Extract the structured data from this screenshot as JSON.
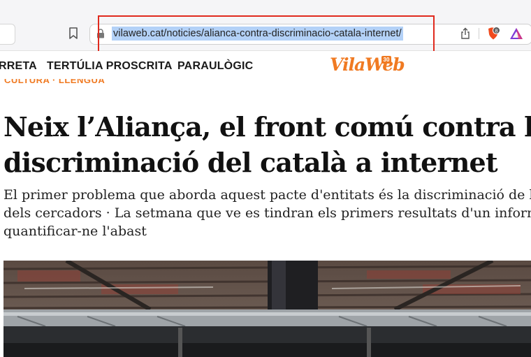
{
  "browser": {
    "url": "vilaweb.cat/noticies/alianca-contra-discriminacio-catala-internet/",
    "icons": [
      "bookmark-icon",
      "lock-icon",
      "share-icon",
      "brave-shields-icon",
      "brave-rewards-icon"
    ],
    "shields_count": "8"
  },
  "site": {
    "nav": [
      "RRETA",
      "TERTÚLIA PROSCRITA",
      "PARAULÒGIC"
    ],
    "logo": "VilaWeb",
    "logo_badge": "30",
    "brand_color": "#f07a22"
  },
  "article": {
    "section": "CULTURA · LLENGUA",
    "headline_line1": "Neix l’Aliança, el front comú contra la",
    "headline_line2": "discriminació del català a internet",
    "standfirst_line1": "El primer problema que aborda aquest pacte d'entitats és la discriminació de la llengua",
    "standfirst_line2": "dels cercadors · La setmana que ve es tindran els primers resultats d'un informe per",
    "standfirst_line3": "quantificar-ne l'abast"
  },
  "annotation": {
    "color": "#e02a1e"
  }
}
